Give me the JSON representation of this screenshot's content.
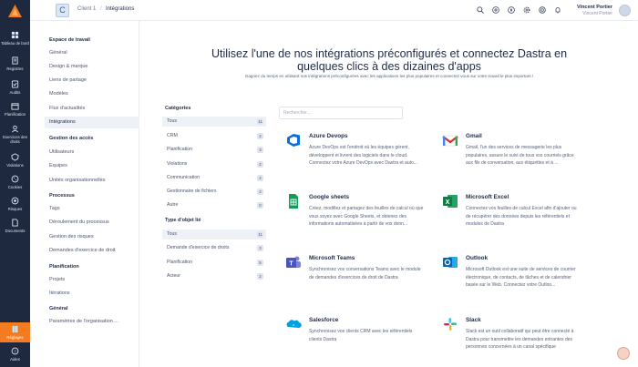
{
  "nav": {
    "items": [
      {
        "label": "Tableau de bord",
        "icon": "dashboard-icon"
      },
      {
        "label": "Registres",
        "icon": "registers-icon"
      },
      {
        "label": "Audits",
        "icon": "audits-icon"
      },
      {
        "label": "Planification",
        "icon": "planning-icon"
      },
      {
        "label": "Exercices des droits",
        "icon": "rights-icon"
      },
      {
        "label": "Violations",
        "icon": "violations-icon"
      },
      {
        "label": "Cookies",
        "icon": "cookies-icon"
      },
      {
        "label": "Risques",
        "icon": "risks-icon"
      },
      {
        "label": "Documents",
        "icon": "documents-icon"
      },
      {
        "label": "Réglages",
        "icon": "settings-icon"
      },
      {
        "label": "Aides",
        "icon": "help-icon"
      }
    ]
  },
  "header": {
    "client_initial": "C",
    "breadcrumb": [
      "Client 1",
      "Intégrations"
    ],
    "user_name": "Vincent Portier",
    "user_sub": "Vincent Portier"
  },
  "side": {
    "sections": [
      {
        "title": "Espace de travail",
        "items": [
          "Général",
          "Design & marque",
          "Liens de partage",
          "Modèles",
          "Flux d'actualités",
          "Intégrations"
        ]
      },
      {
        "title": "Gestion des accès",
        "items": [
          "Utilisateurs",
          "Equipes",
          "Unités organisationnelles"
        ]
      },
      {
        "title": "Processus",
        "items": [
          "Tags",
          "Déroulement du processus",
          "Gestion des risques",
          "Demandes d'exercice de droit"
        ]
      },
      {
        "title": "Planification",
        "items": [
          "Projets",
          "Itérations"
        ]
      },
      {
        "title": "Général",
        "items": [
          "Paramètres de l'organisation ..."
        ]
      }
    ],
    "selected": "Intégrations"
  },
  "main": {
    "title_line1": "Utilisez l'une de nos intégrations préconfigurés et connectez Dastra en",
    "title_line2": "quelques clics à des dizaines d'apps",
    "subtitle": "Gagnez du temps en utilisant nos intégrations préconfigurées avec les applications les plus populaires et connectez vous sur votre travail le plus important !",
    "search_placeholder": "Rechercher...",
    "categories_title": "Catégories",
    "categories": [
      {
        "label": "Tous",
        "count": "11"
      },
      {
        "label": "CRM",
        "count": "2"
      },
      {
        "label": "Planification",
        "count": "3"
      },
      {
        "label": "Violations",
        "count": "2"
      },
      {
        "label": "Communication",
        "count": "4"
      },
      {
        "label": "Gestionnaire de fichiers",
        "count": "2"
      },
      {
        "label": "Autre",
        "count": "0"
      }
    ],
    "object_title": "Type d'objet lié",
    "objects": [
      {
        "label": "Tous",
        "count": "11"
      },
      {
        "label": "Demande d'exercice de droits",
        "count": "3"
      },
      {
        "label": "Planification",
        "count": "5"
      },
      {
        "label": "Acteur",
        "count": "2"
      }
    ],
    "integrations": [
      {
        "name": "Azure Devops",
        "icon": "azure-devops-icon",
        "desc": "Azure DevOps est l'endroit où les équipes gèrent, développent et livrent des logiciels dans le cloud. Connectez votre Azure DevOps avec Dastra et auto..."
      },
      {
        "name": "Gmail",
        "icon": "gmail-icon",
        "desc": "Gmail, l'un des services de messagerie les plus populaires, assure le suivi de tous vos courriels grâce aux fils de conversation, aux étiquettes et à ..."
      },
      {
        "name": "Google sheets",
        "icon": "google-sheets-icon",
        "desc": "Créez, modifiez et partagez des feuilles de calcul où que vous soyez avec Google Sheets, et obtenez des informations automatisées à partir de vos donn..."
      },
      {
        "name": "Microsoft Excel",
        "icon": "excel-icon",
        "desc": "Connectez vos feuilles de calcul Excel afin d'ajouter ou de récupérer des données depuis les référentiels et modules de Dastra"
      },
      {
        "name": "Microsoft Teams",
        "icon": "teams-icon",
        "desc": "Synchronisez vos conversations Teams avec le module de demandes d'exercices de droit de Dastra"
      },
      {
        "name": "Outlook",
        "icon": "outlook-icon",
        "desc": "Microsoft Outlook est une suite de services de courrier électronique, de contacts, de tâches et de calendrier basée sur le Web. Connectez votre Outloo..."
      },
      {
        "name": "Salesforce",
        "icon": "salesforce-icon",
        "desc": "Synchronisez vos clients CRM avec les référentiels clients Dastra"
      },
      {
        "name": "Slack",
        "icon": "slack-icon",
        "desc": "Slack est un outil collaboratif qui peut être connecté à Dastra pour transmettre les demandes entrantes des personnes concernées à un canal spécifique"
      }
    ]
  },
  "colors": {
    "nav_bg": "#1e2940",
    "accent": "#f47b20",
    "selected_bg": "#eef1f6"
  }
}
